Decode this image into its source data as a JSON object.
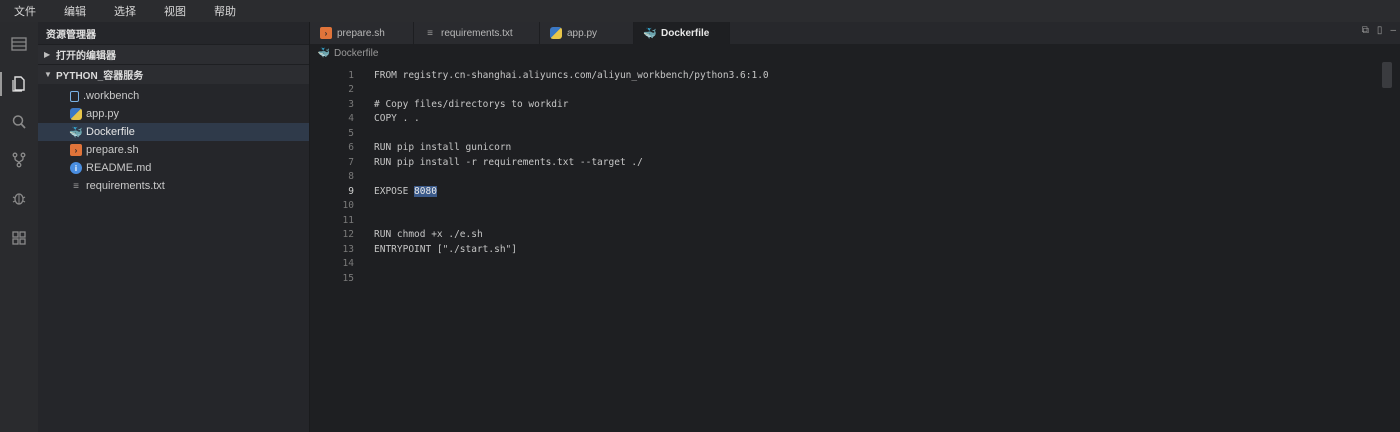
{
  "menubar": {
    "items": [
      "文件",
      "编辑",
      "选择",
      "视图",
      "帮助"
    ]
  },
  "activitybar": {
    "icons": [
      "panel-icon",
      "files-icon",
      "search-icon",
      "source-control-icon",
      "debug-icon",
      "extensions-icon"
    ]
  },
  "sidebar": {
    "title": "资源管理器",
    "open_editors_label": "打开的编辑器",
    "project_label": "PYTHON_容器服务",
    "files": [
      {
        "name": ".workbench",
        "icon": "file-icon",
        "color": "#7ab3e6"
      },
      {
        "name": "app.py",
        "icon": "python-icon",
        "color": "#e8c64a"
      },
      {
        "name": "Dockerfile",
        "icon": "docker-icon",
        "color": "#3d8fd6",
        "selected": true
      },
      {
        "name": "prepare.sh",
        "icon": "shell-icon",
        "color": "#e0743a"
      },
      {
        "name": "README.md",
        "icon": "info-icon",
        "color": "#4a8ee0"
      },
      {
        "name": "requirements.txt",
        "icon": "text-file-icon",
        "color": "#9a9a9a"
      }
    ]
  },
  "tabs": [
    {
      "label": "prepare.sh",
      "icon": "shell-icon",
      "color": "#e0743a"
    },
    {
      "label": "requirements.txt",
      "icon": "text-file-icon",
      "color": "#9a9a9a"
    },
    {
      "label": "app.py",
      "icon": "python-icon",
      "color": "#e8c64a"
    },
    {
      "label": "Dockerfile",
      "icon": "docker-icon",
      "color": "#3d8fd6",
      "active": true
    }
  ],
  "breadcrumb": {
    "file": "Dockerfile"
  },
  "editor": {
    "current_line": 9,
    "lines": [
      "FROM registry.cn-shanghai.aliyuncs.com/aliyun_workbench/python3.6:1.0",
      "",
      "# Copy files/directorys to workdir",
      "COPY . .",
      "",
      "RUN pip install gunicorn",
      "RUN pip install -r requirements.txt --target ./",
      "",
      "EXPOSE ",
      "",
      "",
      "RUN chmod +x ./e.sh",
      "ENTRYPOINT [\"./start.sh\"]",
      "",
      ""
    ],
    "selected_text": "8080"
  }
}
